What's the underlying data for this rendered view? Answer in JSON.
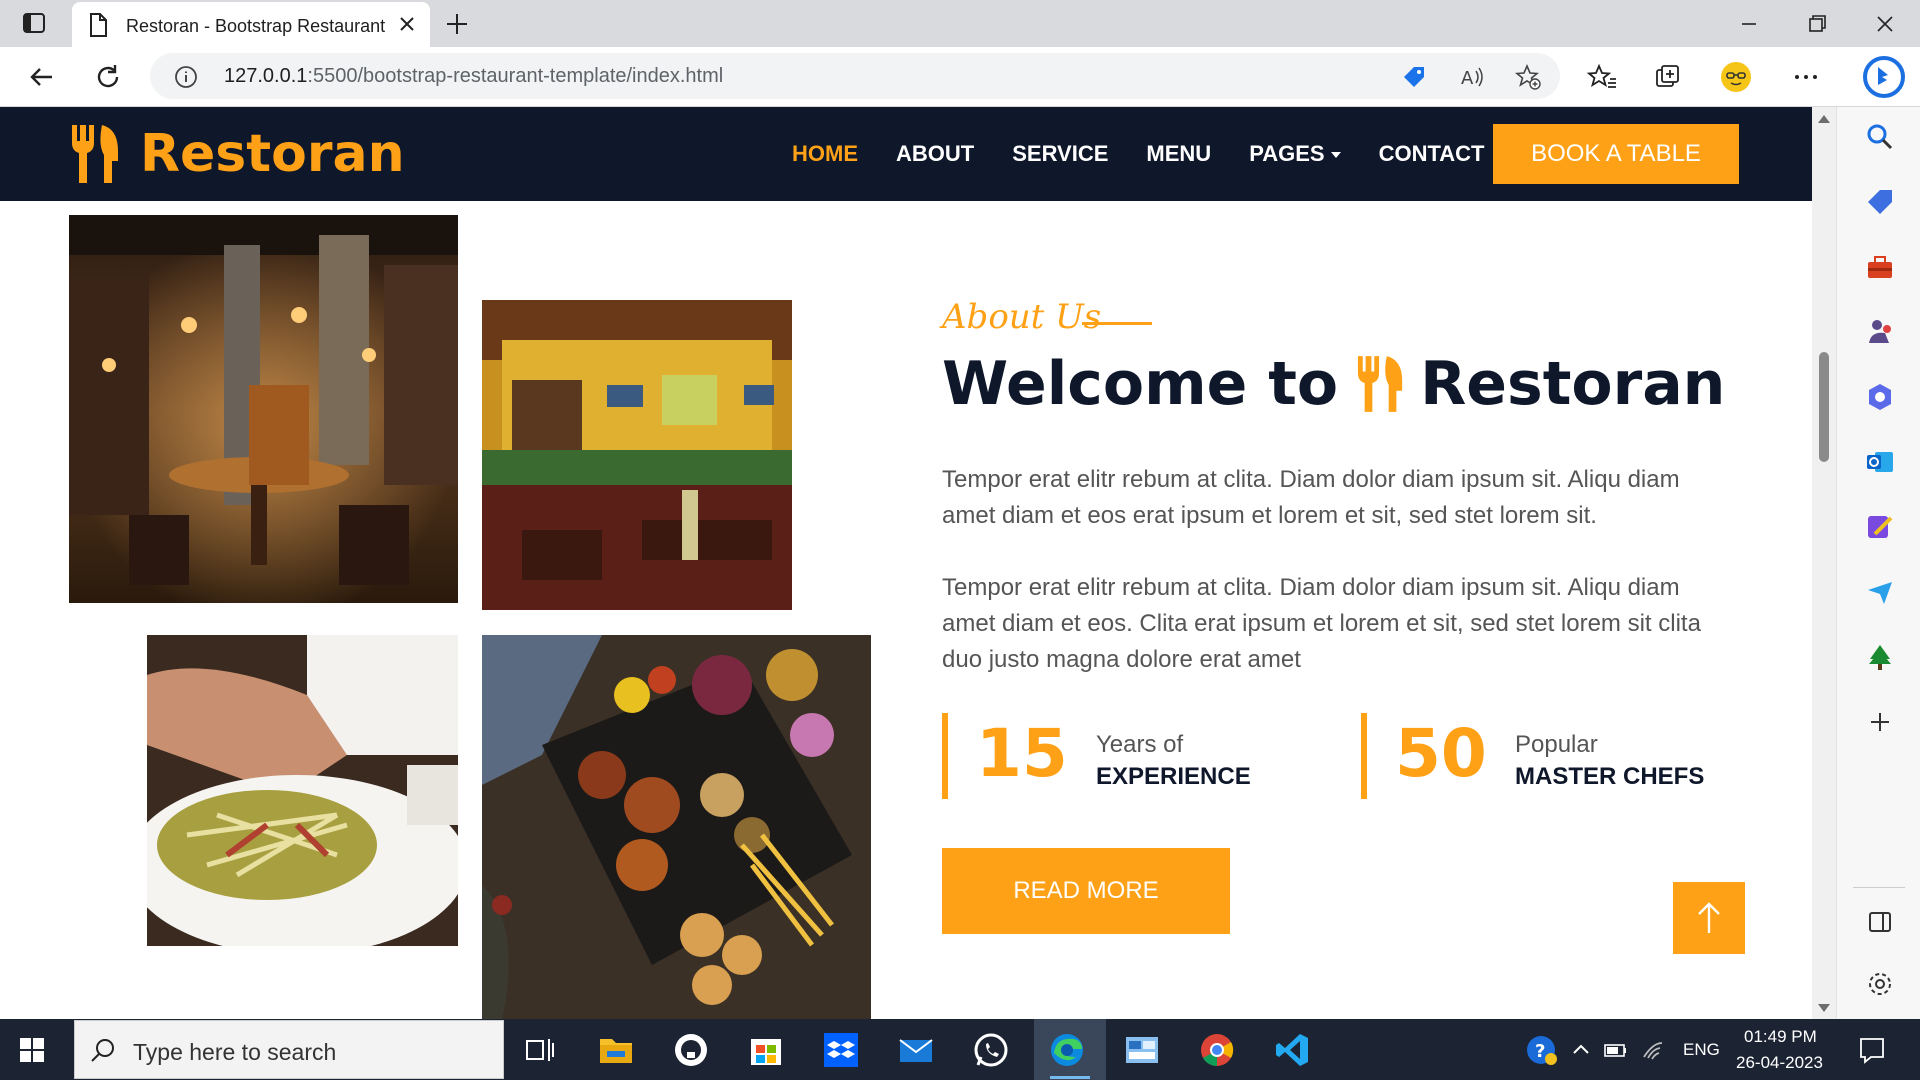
{
  "browser": {
    "tab_title": "Restoran - Bootstrap Restaurant",
    "url_host": "127.0.0.1",
    "url_path": ":5500/bootstrap-restaurant-template/index.html"
  },
  "site": {
    "brand": "Restoran",
    "nav": [
      "HOME",
      "ABOUT",
      "SERVICE",
      "MENU",
      "PAGES",
      "CONTACT"
    ],
    "active_nav": "HOME",
    "book_button": "BOOK A TABLE",
    "accent_color": "#fea116",
    "dark_color": "#0f172b"
  },
  "about": {
    "label": "About Us",
    "heading_prefix": "Welcome to",
    "heading_brand": "Restoran",
    "paragraph_1": "Tempor erat elitr rebum at clita. Diam dolor diam ipsum sit. Aliqu diam amet diam et eos erat ipsum et lorem et sit, sed stet lorem sit.",
    "paragraph_2": "Tempor erat elitr rebum at clita. Diam dolor diam ipsum sit. Aliqu diam amet diam et eos. Clita erat ipsum et lorem et sit, sed stet lorem sit clita duo justo magna dolore erat amet",
    "stats": [
      {
        "number": "15",
        "label_top": "Years of",
        "label_bottom": "EXPERIENCE"
      },
      {
        "number": "50",
        "label_top": "Popular",
        "label_bottom": "MASTER CHEFS"
      }
    ],
    "read_more": "READ MORE"
  },
  "taskbar": {
    "search_placeholder": "Type here to search",
    "language": "ENG",
    "time": "01:49 PM",
    "date": "26-04-2023"
  }
}
